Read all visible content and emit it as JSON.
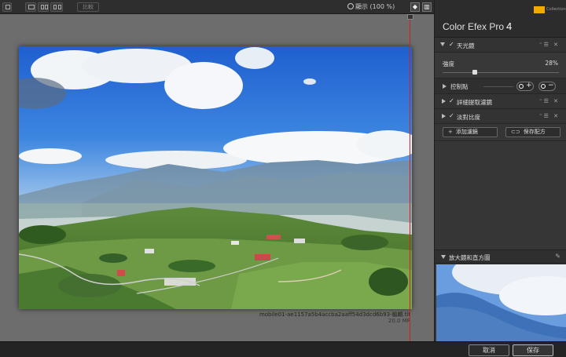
{
  "toolbar": {
    "compare_label": "比較",
    "zoom_label": "顯示 (100 %)"
  },
  "canvas": {
    "file_name": "mobile01-ae1157a5b4accba2aaff54d3dcd6b93-編輯.tif",
    "file_size": "20.0 MP"
  },
  "panel": {
    "product_title": "Color Efex Pro",
    "product_version": "4",
    "logo_text": "Collection",
    "filters": [
      {
        "label": "天光鏡",
        "checked": "✓",
        "controls": "⁼☰ ✕"
      },
      {
        "label": "詳細提取濾鏡",
        "checked": "✓",
        "controls": "⁼☰ ✕"
      },
      {
        "label": "淡對比度",
        "checked": "✓",
        "controls": "⁼☰ ✕"
      }
    ],
    "strength_label": "強度",
    "strength_value": "28%",
    "strength_fraction": 0.28,
    "control_points_label": "控制點",
    "add_filter_label": "添加濾鏡",
    "save_recipe_label": "保存配方",
    "loupe_label": "放大鏡和直方圖"
  },
  "bottom": {
    "cancel_label": "取消",
    "save_label": "保存"
  },
  "colors": {
    "split_line": "#d02020",
    "logo": "#f2a900"
  }
}
